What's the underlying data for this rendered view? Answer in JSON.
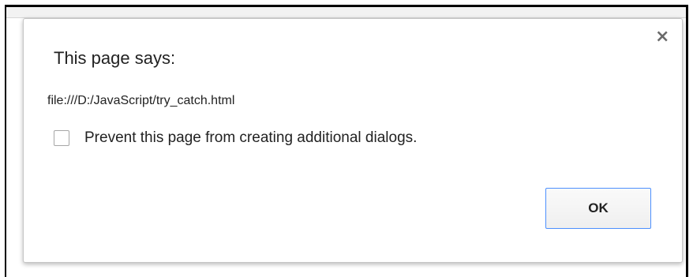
{
  "dialog": {
    "title": "This page says:",
    "message": "file:///D:/JavaScript/try_catch.html",
    "close_icon": "close-icon",
    "checkbox": {
      "label": "Prevent this page from creating additional dialogs.",
      "checked": false
    },
    "ok_label": "OK"
  },
  "colors": {
    "button_border": "#4d90fe",
    "text": "#222222",
    "dialog_border": "#c6c6c6"
  }
}
